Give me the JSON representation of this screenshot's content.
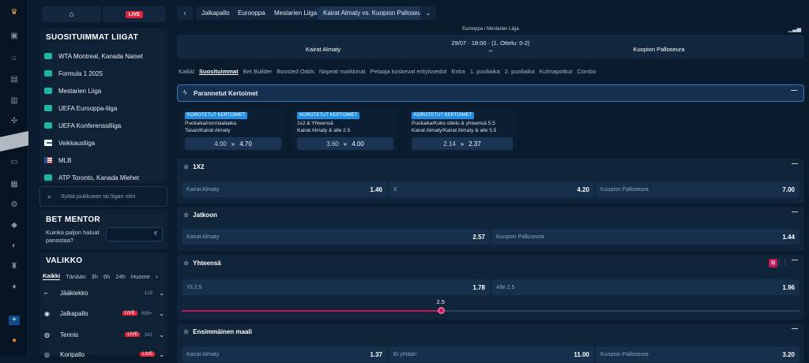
{
  "rail": {
    "icons": [
      "trophy-icon",
      "gift-icon",
      "bank-icon",
      "document-icon",
      "bet-icon",
      "puzzle-icon",
      "promo-icon",
      "card-icon",
      "cash-icon",
      "settings-icon",
      "diamond-icon",
      "chat-icon",
      "crown-icon",
      "gem-icon",
      "flag-fi-icon",
      "coin-icon"
    ]
  },
  "left": {
    "live_label": "LIVE",
    "popular_title": "SUOSITUIMMAT LIIGAT",
    "leagues": [
      {
        "label": "WTA Montreal, Kanada Naiset",
        "icon": "tennis-icon"
      },
      {
        "label": "Formula 1 2025",
        "icon": "motorsport-icon"
      },
      {
        "label": "Mestarien Liiga",
        "icon": "football-icon"
      },
      {
        "label": "UEFA Eurooppa-liiga",
        "icon": "football-icon"
      },
      {
        "label": "UEFA Konferenssiliiga",
        "icon": "football-icon"
      },
      {
        "label": "Veikkausliiga",
        "icon": "flag-fi-icon"
      },
      {
        "label": "MLB",
        "icon": "flag-us-icon"
      },
      {
        "label": "ATP Toronto, Kanada Miehet",
        "icon": "tennis-icon"
      }
    ],
    "search_placeholder": "Syötä joukkueen tai liigan nimi",
    "bet_mentor_title": "BET MENTOR",
    "bet_mentor_question": "Kuinka paljon haluat panostaa?",
    "currency": "€",
    "menu_title": "VALIKKO",
    "time_filters": [
      "Kaikki",
      "Tänään",
      "3h",
      "6h",
      "24h",
      "Huome"
    ],
    "sports": [
      {
        "label": "Jääkiekko",
        "count": "128",
        "live": ""
      },
      {
        "label": "Jalkapallo",
        "count": "999+",
        "live": "LIVE"
      },
      {
        "label": "Tennis",
        "count": "341",
        "live": "LIVE"
      },
      {
        "label": "Koripallo",
        "count": "",
        "live": "LIVE"
      }
    ]
  },
  "breadcrumbs": [
    "Jalkapallo",
    "Eurooppa",
    "Mestarien Liiga",
    "Kairat Almaty vs. Kuopion Palloseura"
  ],
  "match": {
    "competition": "Eurooppa / Mestarien Liiga",
    "datetime": "29/07 · 18:00 · (1. Ottelu: 0-2)",
    "home": "Kairat Almaty",
    "vs": "vs",
    "away": "Kuopion Palloseura"
  },
  "market_tabs": [
    "Kaikki",
    "Suosituimmat",
    "Bet Builder",
    "Boosted Odds",
    "Nopeat markkinat",
    "Pelaaja koskevat erityisvedot",
    "Extra",
    "1. puoliaika",
    "2. puoliaika",
    "Kulmapotkut",
    "Combo"
  ],
  "enhanced": {
    "title": "Parannetut Kertoimet",
    "cards": [
      {
        "tag": "KOROTETUT KERTOIMET",
        "line1": "Puoliaika/normaaliaika",
        "line2": "Tasan/Kairat Almaty",
        "old": "4.00",
        "new": "4.70"
      },
      {
        "tag": "KOROTETUT KERTOIMET",
        "line1": "1x2 & Yhteensä",
        "line2": "Kairat Almaty & alle 2.5",
        "old": "3.60",
        "new": "4.00"
      },
      {
        "tag": "KOROTETUT KERTOIMET",
        "line1": "Puoliaika/Koko ottelu & yhteensä 5.5",
        "line2": "Kairat Almaty/Kairat Almaty & alle 5.5",
        "old": "2.14",
        "new": "2.37"
      }
    ]
  },
  "markets": {
    "x12": {
      "title": "1X2",
      "odds": [
        {
          "label": "Kairat Almaty",
          "value": "1.46"
        },
        {
          "label": "X",
          "value": "4.20"
        },
        {
          "label": "Kuopion Palloseura",
          "value": "7.00"
        }
      ]
    },
    "jatkoon": {
      "title": "Jatkoon",
      "odds": [
        {
          "label": "Kairat Almaty",
          "value": "2.57"
        },
        {
          "label": "Kuopion Palloseura",
          "value": "1.44"
        }
      ]
    },
    "yhteensa": {
      "title": "Yhteensä",
      "odds": [
        {
          "label": "Yli 2.5",
          "value": "1.78"
        },
        {
          "label": "Alle 2.5",
          "value": "1.96"
        }
      ],
      "slider_value": "2.5",
      "slider_fraction": 0.42
    },
    "ensimmainen": {
      "title": "Ensimmäinen maali",
      "odds": [
        {
          "label": "Kairat Almaty",
          "value": "1.37"
        },
        {
          "label": "Ei yhtään",
          "value": "11.00"
        },
        {
          "label": "Kuopion Palloseura",
          "value": "3.20"
        }
      ]
    }
  }
}
